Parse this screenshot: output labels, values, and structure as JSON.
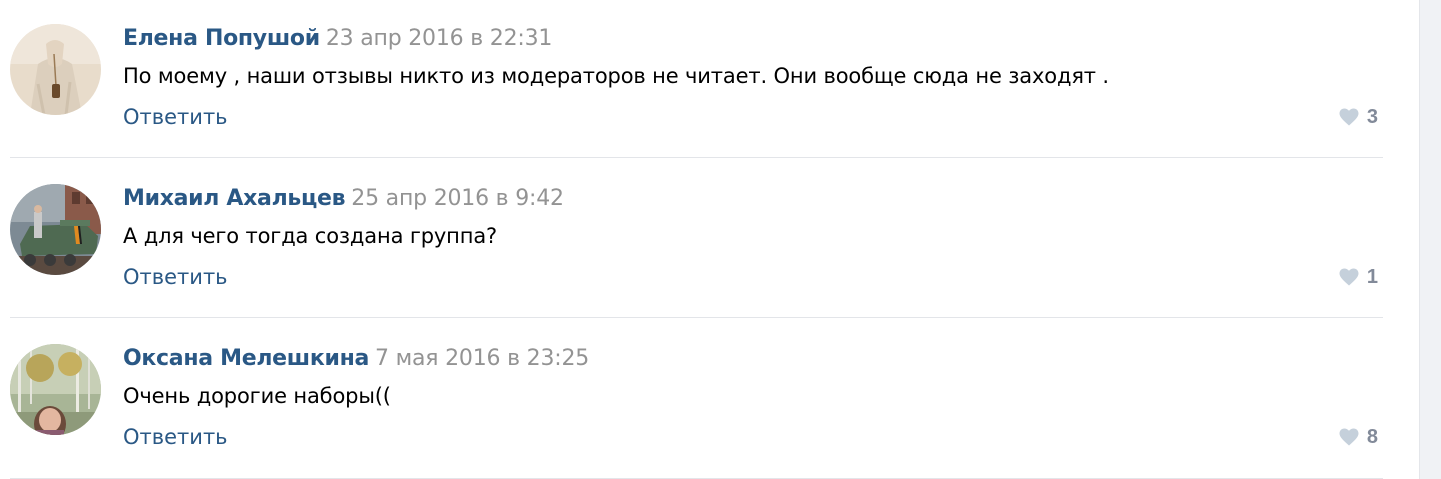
{
  "comments": [
    {
      "author": "Елена Попушой",
      "date": "23 апр 2016 в 22:31",
      "text": "По моему , наши отзывы никто из модераторов не читает. Они вообще сюда не заходят .",
      "reply_label": "Ответить",
      "likes": "3"
    },
    {
      "author": "Михаил Ахальцев",
      "date": "25 апр 2016 в 9:42",
      "text": "А для чего тогда создана группа?",
      "reply_label": "Ответить",
      "likes": "1"
    },
    {
      "author": "Оксана Мелешкина",
      "date": "7 мая 2016 в 23:25",
      "text": "Очень дорогие наборы((",
      "reply_label": "Ответить",
      "likes": "8"
    }
  ],
  "icons": {
    "like": "heart-icon"
  },
  "colors": {
    "author": "#2a5885",
    "date": "#939393",
    "like_icon": "#c5d0db",
    "like_count": "#828a99"
  }
}
